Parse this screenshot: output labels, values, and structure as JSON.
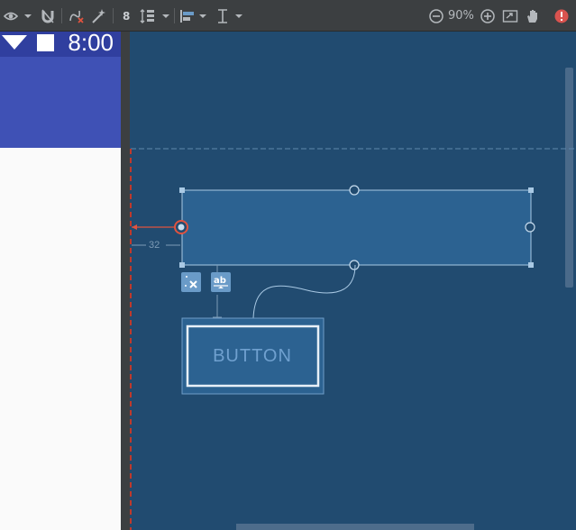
{
  "toolbar": {
    "margin_value": "8",
    "zoom_level": "90%",
    "icons": [
      "eye-icon",
      "magnet-icon",
      "clear-constraints-icon",
      "magic-wand-icon",
      "pack-icon",
      "align-icon",
      "guideline-icon",
      "zoom-out-icon",
      "zoom-in-icon",
      "zoom-fit-icon",
      "pan-icon",
      "error-icon"
    ],
    "error_color": "#d9534f"
  },
  "phone": {
    "time": "8:00",
    "status_color": "#303f9f",
    "appbar_color": "#3f51b5"
  },
  "blueprint": {
    "background": "#214b70",
    "margin_label": "32",
    "button_text": "BUTTON"
  }
}
